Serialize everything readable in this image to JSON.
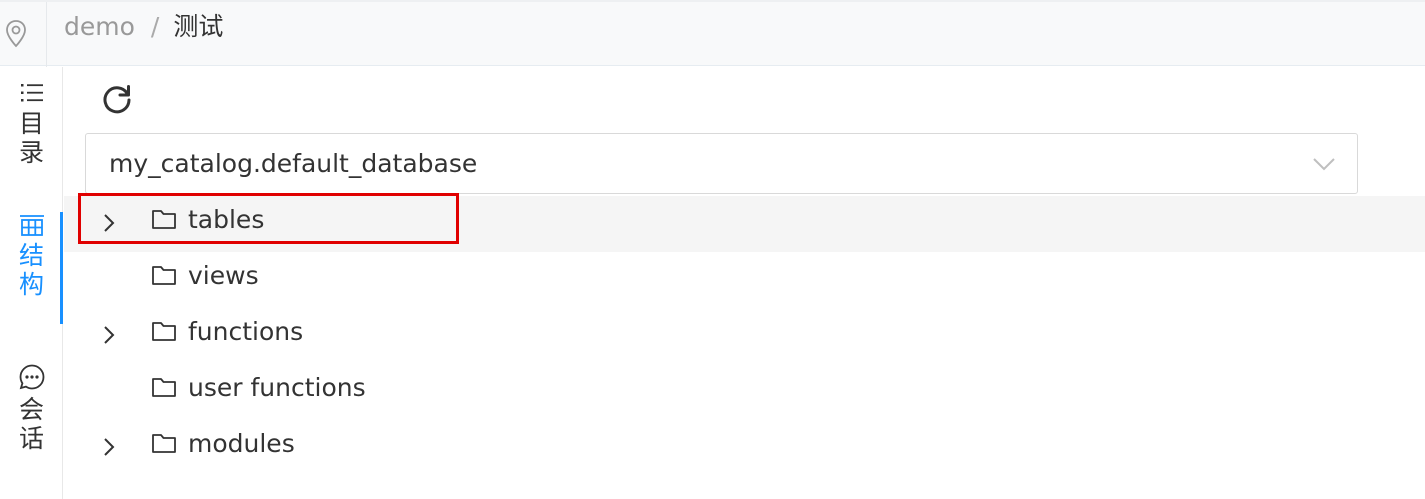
{
  "header": {
    "location_icon": "location-pin-icon",
    "breadcrumb": [
      "demo",
      "测试"
    ],
    "separator": "/"
  },
  "sidebar": {
    "tabs": [
      {
        "icon": "list-icon",
        "label": "目录",
        "active": false
      },
      {
        "icon": "table-icon",
        "label": "结构",
        "active": true
      },
      {
        "icon": "chat-icon",
        "label": "会话",
        "active": false
      }
    ],
    "accent_color": "#1890ff"
  },
  "toolbar": {
    "refresh_icon": "refresh-icon"
  },
  "database_select": {
    "value": "my_catalog.default_database",
    "icon": "chevron-down-icon"
  },
  "tree": {
    "items": [
      {
        "label": "tables",
        "expandable": true,
        "icon": "folder-icon",
        "highlighted": true
      },
      {
        "label": "views",
        "expandable": false,
        "icon": "folder-icon"
      },
      {
        "label": "functions",
        "expandable": true,
        "icon": "folder-icon"
      },
      {
        "label": "user functions",
        "expandable": false,
        "icon": "folder-icon"
      },
      {
        "label": "modules",
        "expandable": true,
        "icon": "folder-icon"
      }
    ],
    "highlight_color": "#e00000"
  }
}
